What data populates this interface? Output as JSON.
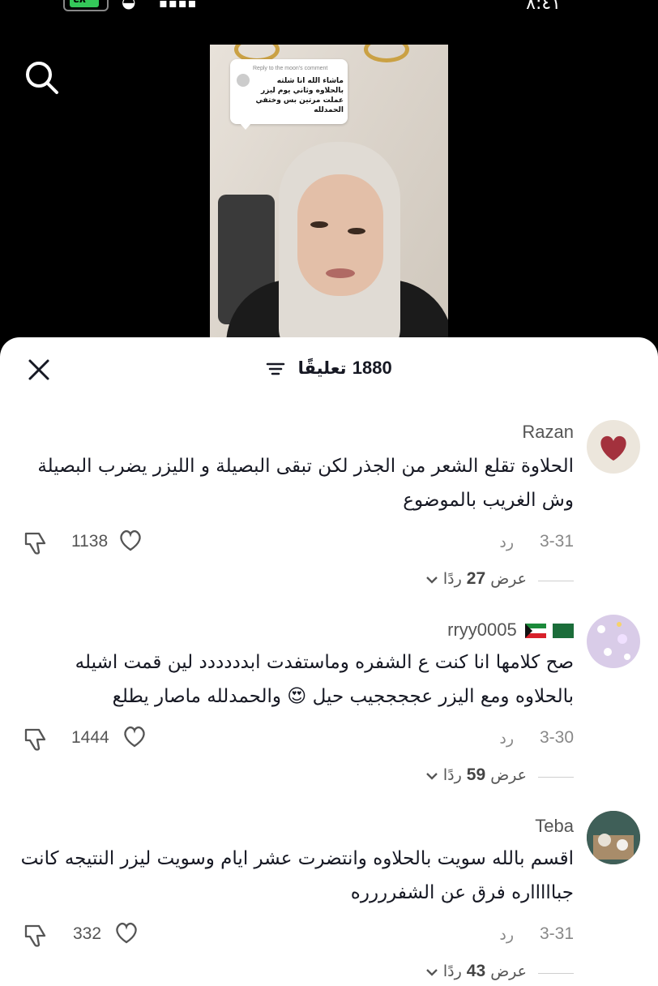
{
  "status_bar": {
    "battery": "٤٨",
    "time": "٨:٤١"
  },
  "video": {
    "reply_header": "Reply to the moon's comment",
    "reply_text": "ماشاء الله انا شلته بالحلاوه وثاني يوم ليزر عملت مرتين بس وختفي الحمدلله"
  },
  "sheet": {
    "count": "1880",
    "label": "تعليقًا"
  },
  "comments": [
    {
      "username": "Razan",
      "text": "الحلاوة تقلع الشعر من الجذر لكن تبقى البصيلة و الليزر يضرب البصيلة وش الغريب بالموضوع",
      "date": "3-31",
      "reply_label": "رد",
      "likes": "1138",
      "view_label": "عرض",
      "replies_count": "27",
      "replies_unit": "ردًا"
    },
    {
      "username": "rryy0005",
      "text": "صح كلامها انا كنت ع الشفره وماستفدت ابدددددد لين قمت اشيله بالحلاوه ومع اليزر عججججيب حيل 😍 والحمدلله ماصار يطلع",
      "date": "3-30",
      "reply_label": "رد",
      "likes": "1444",
      "view_label": "عرض",
      "replies_count": "59",
      "replies_unit": "ردًا"
    },
    {
      "username": "Teba",
      "text": "اقسم بالله سويت بالحلاوه وانتضرت عشر ايام وسويت ليزر النتيجه كانت جباااااره فرق عن الشفرررره",
      "date": "3-31",
      "reply_label": "رد",
      "likes": "332",
      "view_label": "عرض",
      "replies_count": "43",
      "replies_unit": "ردًا"
    }
  ],
  "colors": {
    "sheet_bg": "#ffffff",
    "text": "#161823",
    "muted": "#888888",
    "battery": "#34c759"
  }
}
